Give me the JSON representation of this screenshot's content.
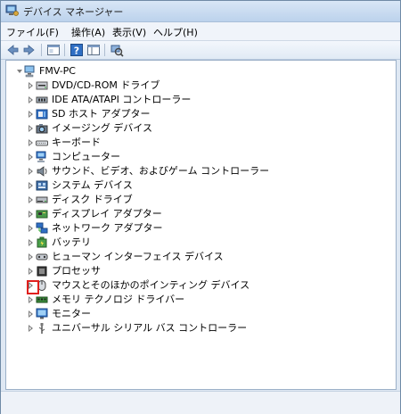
{
  "window": {
    "title": "デバイス マネージャー"
  },
  "menu": [
    {
      "label": "ファイル(F)"
    },
    {
      "label": "操作(A)"
    },
    {
      "label": "表示(V)"
    },
    {
      "label": "ヘルプ(H)"
    }
  ],
  "toolbar_buttons": [
    {
      "name": "back-button-icon"
    },
    {
      "name": "forward-button-icon"
    },
    {
      "name": "properties-window-icon"
    },
    {
      "name": "help-icon"
    },
    {
      "name": "console-tree-icon"
    },
    {
      "name": "scan-hardware-icon"
    }
  ],
  "tree": {
    "root": {
      "label": "FMV-PC",
      "icon": "computer-icon"
    },
    "items": [
      {
        "label": "DVD/CD-ROM ドライブ",
        "icon": "optical-drive-icon"
      },
      {
        "label": "IDE ATA/ATAPI コントローラー",
        "icon": "ide-controller-icon"
      },
      {
        "label": "SD ホスト アダプター",
        "icon": "sd-host-icon"
      },
      {
        "label": "イメージング デバイス",
        "icon": "camera-icon"
      },
      {
        "label": "キーボード",
        "icon": "keyboard-icon"
      },
      {
        "label": "コンピューター",
        "icon": "computer-icon"
      },
      {
        "label": "サウンド、ビデオ、およびゲーム コントローラー",
        "icon": "speaker-icon"
      },
      {
        "label": "システム デバイス",
        "icon": "system-device-icon"
      },
      {
        "label": "ディスク ドライブ",
        "icon": "disk-drive-icon"
      },
      {
        "label": "ディスプレイ アダプター",
        "icon": "display-adapter-icon"
      },
      {
        "label": "ネットワーク アダプター",
        "icon": "network-adapter-icon"
      },
      {
        "label": "バッテリ",
        "icon": "battery-icon"
      },
      {
        "label": "ヒューマン インターフェイス デバイス",
        "icon": "hid-icon"
      },
      {
        "label": "プロセッサ",
        "icon": "processor-icon"
      },
      {
        "label": "マウスとそのほかのポインティング デバイス",
        "icon": "mouse-icon"
      },
      {
        "label": "メモリ テクノロジ ドライバー",
        "icon": "memory-icon"
      },
      {
        "label": "モニター",
        "icon": "monitor-icon"
      },
      {
        "label": "ユニバーサル シリアル バス コントローラー",
        "icon": "usb-icon"
      }
    ]
  },
  "colors": {
    "highlight": "#e0201e",
    "title_bar": "#bcd2ec"
  }
}
